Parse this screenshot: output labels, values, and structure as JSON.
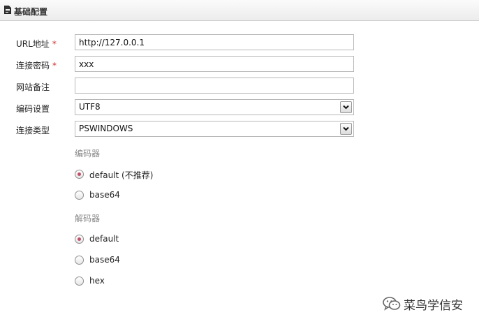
{
  "header": {
    "title": "基础配置",
    "icon": "document-icon"
  },
  "form": {
    "url": {
      "label": "URL地址",
      "required_mark": "*",
      "value": "http://127.0.0.1"
    },
    "password": {
      "label": "连接密码",
      "required_mark": "*",
      "value": "xxx"
    },
    "note": {
      "label": "网站备注",
      "value": ""
    },
    "encoding": {
      "label": "编码设置",
      "value": "UTF8"
    },
    "type": {
      "label": "连接类型",
      "value": "PSWINDOWS"
    }
  },
  "encoder": {
    "title": "编码器",
    "options": [
      {
        "label": "default (不推荐)",
        "checked": true
      },
      {
        "label": "base64",
        "checked": false
      }
    ]
  },
  "decoder": {
    "title": "解码器",
    "options": [
      {
        "label": "default",
        "checked": true
      },
      {
        "label": "base64",
        "checked": false
      },
      {
        "label": "hex",
        "checked": false
      }
    ]
  },
  "watermark": {
    "text": "菜鸟学信安",
    "icon": "wechat-icon"
  },
  "colors": {
    "required": "#d03030",
    "radio_dot": "#c0506a",
    "group_label": "#888888"
  }
}
